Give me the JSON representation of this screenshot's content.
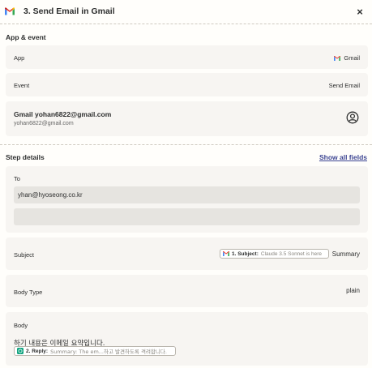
{
  "header": {
    "title": "3. Send Email in Gmail",
    "close": "×"
  },
  "app_event": {
    "section_title": "App & event",
    "app_label": "App",
    "app_value": "Gmail",
    "event_label": "Event",
    "event_value": "Send Email",
    "account_name": "Gmail yohan6822@gmail.com",
    "account_email": "yohan6822@gmail.com"
  },
  "step_details": {
    "section_title": "Step details",
    "show_all": "Show all fields",
    "to_label": "To",
    "to_value": "yhan@hyoseong.co.kr",
    "to_empty": "",
    "subject_label": "Subject",
    "subject_pill_title": "1. Subject:",
    "subject_pill_value": "Claude 3.5 Sonnet is here",
    "subject_suffix": "Summary",
    "body_type_label": "Body Type",
    "body_type_value": "plain",
    "body_label": "Body",
    "body_text": "하기 내용은 이메일 요약입니다.",
    "body_pill_title": "2. Reply:",
    "body_pill_value": "Summary: The em...하고 발견하도록 격려합니다."
  },
  "colors": {
    "gmail_red": "#ea4335",
    "link": "#3d4592",
    "card_bg": "#f7f5f2",
    "chatgpt_green": "#10a37f"
  }
}
